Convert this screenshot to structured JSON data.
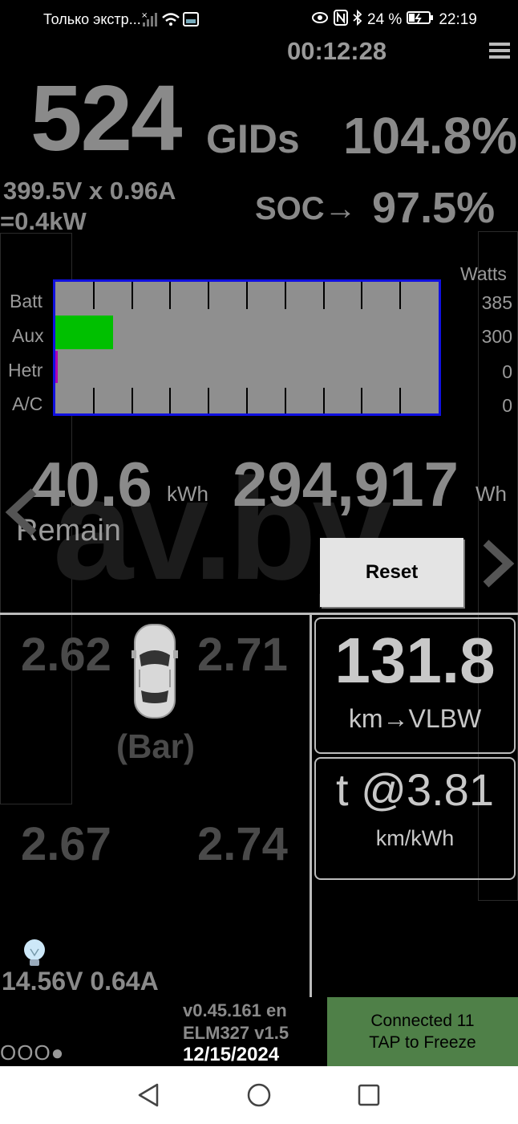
{
  "status_bar": {
    "carrier": "Только экстр...",
    "battery_percent": "24 %",
    "time": "22:19",
    "icons": [
      "signal-icon",
      "wifi-icon",
      "gallery-icon",
      "eye-icon",
      "nfc-icon",
      "bluetooth-icon",
      "battery-charging-icon"
    ]
  },
  "header": {
    "elapsed": "00:12:28",
    "menu_icon": "hamburger-menu-icon"
  },
  "top": {
    "gids": "524",
    "gids_unit": "GIDs",
    "gids_percent": "104.8%",
    "volt_amp": "399.5V x 0.96A",
    "power": "=0.4kW",
    "soc_label": "SOC→",
    "soc_value": "97.5%"
  },
  "watts_chart": {
    "header": "Watts",
    "rows": [
      {
        "label": "Batt",
        "value": "385"
      },
      {
        "label": "Aux",
        "value": "300"
      },
      {
        "label": "Hetr",
        "value": "0"
      },
      {
        "label": "A/C",
        "value": "0"
      }
    ],
    "aux_fraction": 0.15,
    "aux_color": "#00c000",
    "hetr_color": "#b000b0",
    "frame_color": "#1010e0"
  },
  "energy": {
    "remain_kwh": "40.6",
    "kwh_unit": "kWh",
    "remain_label": "Remain",
    "total_wh": "294,917",
    "wh_unit": "Wh",
    "watermark": "av.by"
  },
  "reset_label": "Reset",
  "tires": {
    "front_left": "2.62",
    "front_right": "2.71",
    "rear_left": "2.67",
    "rear_right": "2.74",
    "unit": "(Bar)",
    "car_icon": "car-top-view-icon"
  },
  "range": {
    "value": "131.8",
    "label": "km→VLBW"
  },
  "efficiency": {
    "value": "t @3.81",
    "label": "km/kWh"
  },
  "aux_battery": {
    "icon": "lightbulb-icon",
    "reading": "14.56V 0.64A"
  },
  "footer": {
    "dots": "OOO●",
    "version": "v0.45.161 en",
    "adapter": "ELM327 v1.5",
    "date": "12/15/2024",
    "connected_line1": "Connected 11",
    "connected_line2": "TAP to Freeze",
    "connected_color": "#4f8048"
  },
  "nav": {
    "back": "back-icon",
    "home": "home-icon",
    "recents": "recents-icon"
  }
}
